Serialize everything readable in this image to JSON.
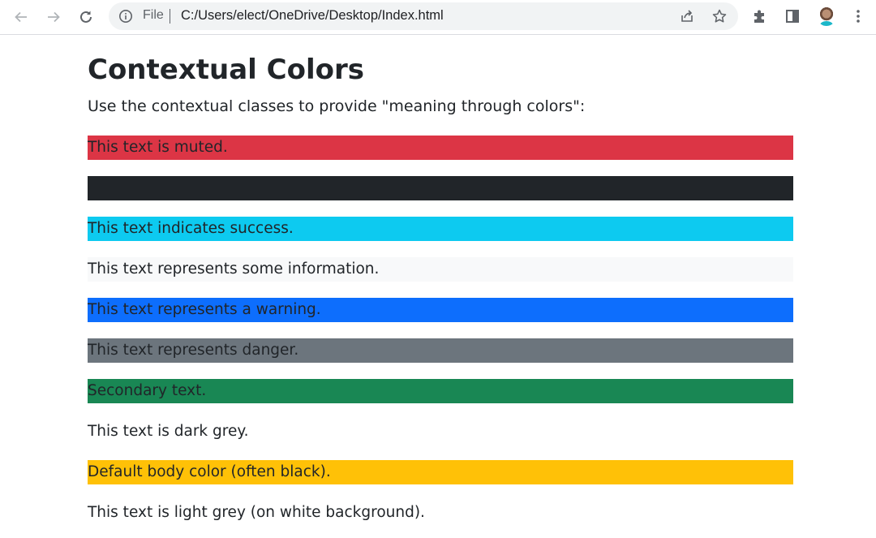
{
  "browser": {
    "file_label": "File",
    "url": "C:/Users/elect/OneDrive/Desktop/Index.html",
    "icons": [
      "back-icon",
      "forward-icon",
      "reload-icon",
      "info-icon",
      "share-icon",
      "star-icon",
      "extensions-icon",
      "side-panel-icon",
      "avatar",
      "menu-icon"
    ]
  },
  "page": {
    "title": "Contextual Colors",
    "intro": "Use the contextual classes to provide \"meaning through colors\":",
    "lines": [
      {
        "text": "This text is muted.",
        "bg": "#dc3545"
      },
      {
        "text": "",
        "bg": "#212529"
      },
      {
        "text": "This text indicates success.",
        "bg": "#0dcaf0"
      },
      {
        "text": "This text represents some information.",
        "bg": "#f8f9fa"
      },
      {
        "text": "This text represents a warning.",
        "bg": "#0d6efd"
      },
      {
        "text": "This text represents danger.",
        "bg": "#6c757d"
      },
      {
        "text": "Secondary text.",
        "bg": "#198754"
      },
      {
        "text": "This text is dark grey.",
        "bg": "#ffffff"
      },
      {
        "text": "Default body color (often black).",
        "bg": "#ffc107"
      },
      {
        "text": "This text is light grey (on white background).",
        "bg": "#ffffff"
      }
    ]
  }
}
